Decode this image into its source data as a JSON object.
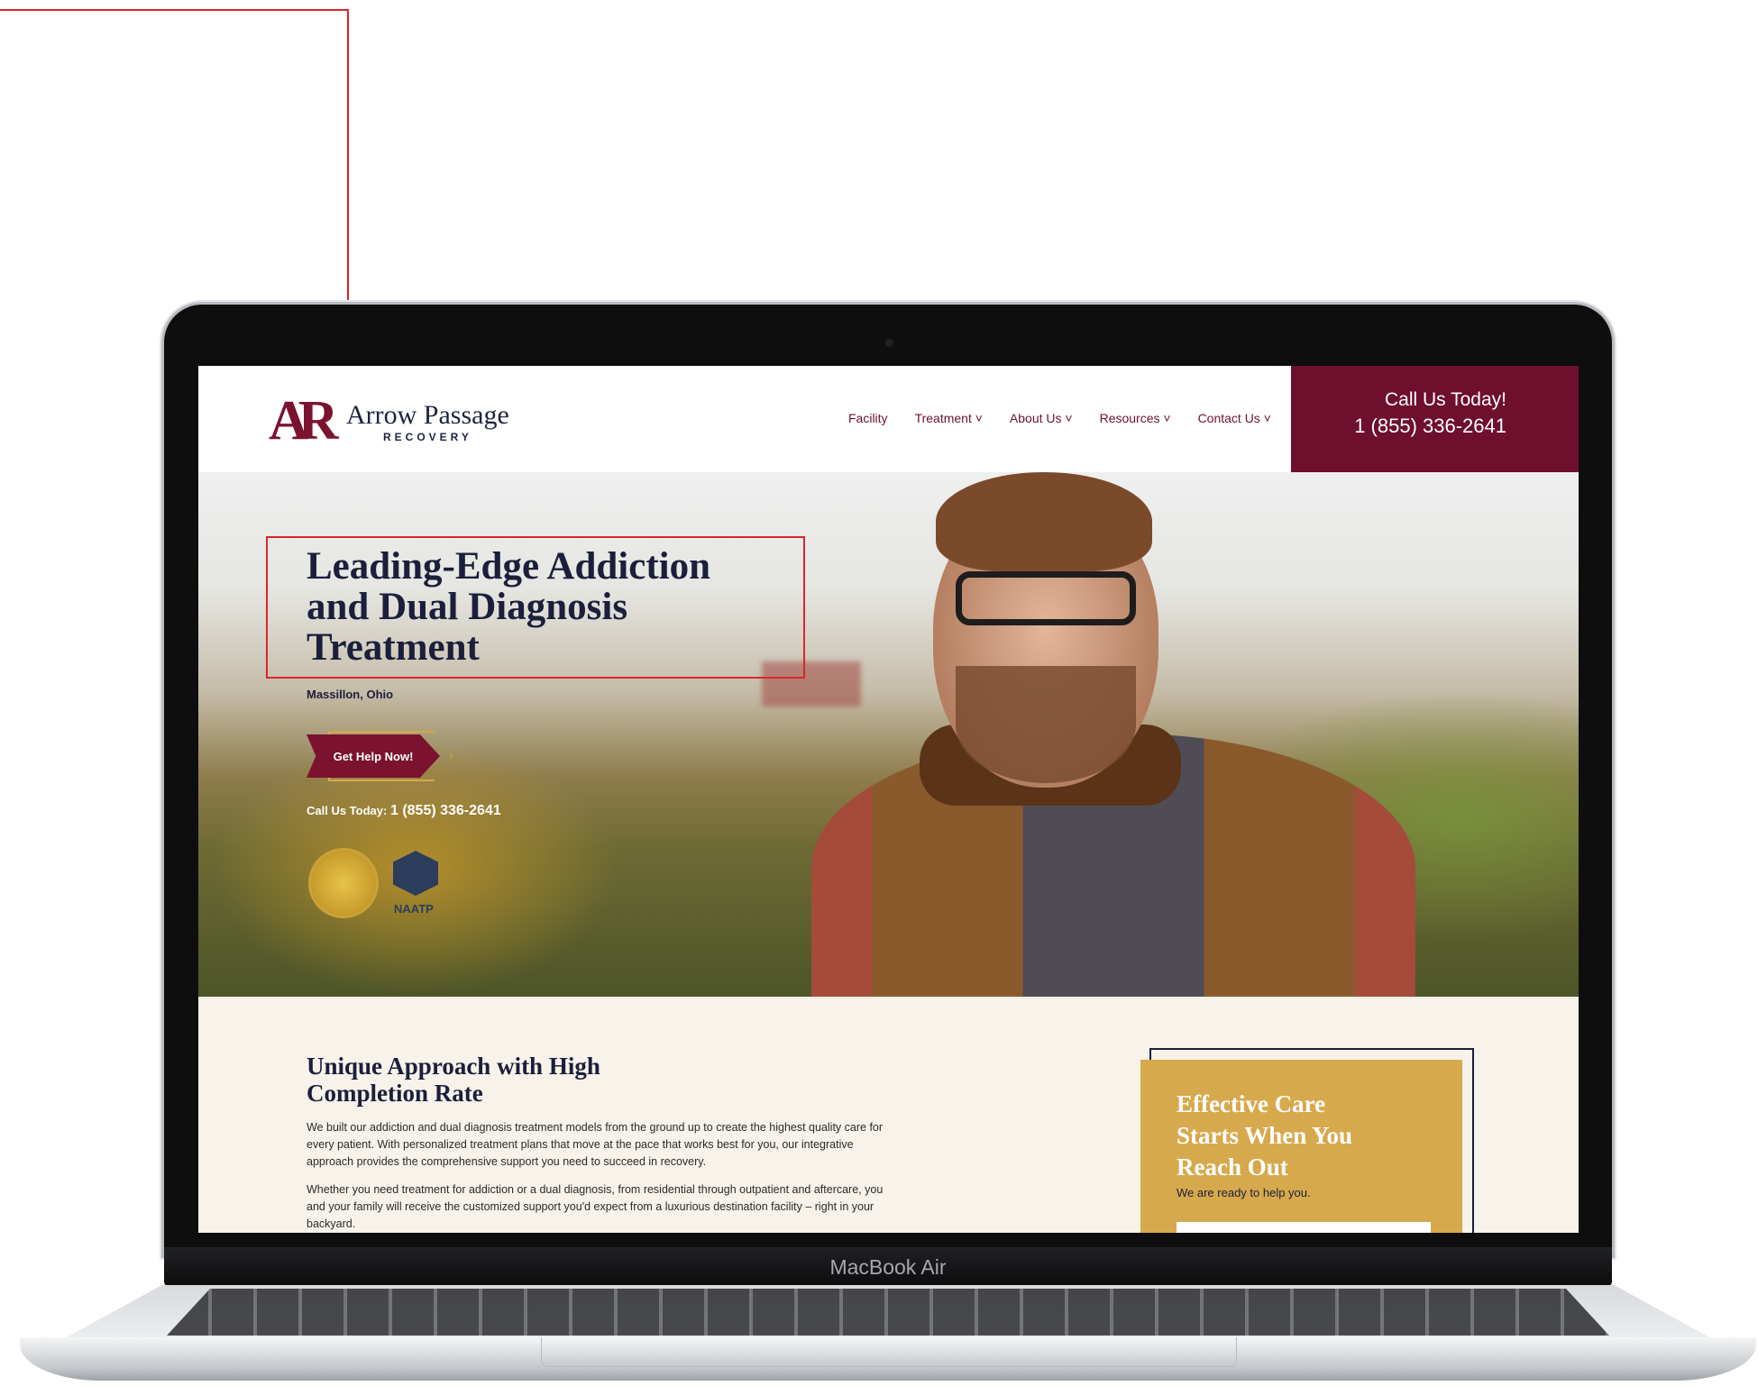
{
  "site": {
    "logo_mark": "AR",
    "logo_name": "Arrow Passage",
    "logo_sub": "RECOVERY"
  },
  "nav": [
    {
      "label": "Facility"
    },
    {
      "label": "Treatment ˅"
    },
    {
      "label": "About Us ˅"
    },
    {
      "label": "Resources ˅"
    },
    {
      "label": "Contact Us ˅"
    }
  ],
  "call_box": {
    "line1": "Call Us Today!",
    "phone": "1 (855) 336-2641"
  },
  "hero": {
    "title": "Leading-Edge Addiction and Dual Diagnosis Treatment",
    "location": "Massillon, Ohio",
    "cta_label": "Get Help Now!",
    "call_label": "Call Us Today:",
    "call_phone": "1 (855) 336-2641",
    "naatp_label": "NAATP"
  },
  "content": {
    "title": "Unique Approach with High Completion Rate",
    "p1": "We built our addiction and dual diagnosis treatment models from the ground up to create the highest quality care for every patient. With personalized treatment plans that move at the pace that works best for you, our integrative approach provides the comprehensive support you need to succeed in recovery.",
    "p2": "Whether you need treatment for addiction or a dual diagnosis, from residential through outpatient and aftercare, you and your family will receive the customized support you'd expect from a luxurious destination facility – right in your backyard."
  },
  "card": {
    "title": "Effective Care Starts When You Reach Out",
    "subtitle": "We are ready to help you."
  },
  "device_label": "MacBook Air",
  "colors": {
    "brand": "#6e0f2e",
    "navy": "#1b1f3b",
    "gold": "#d7a94d",
    "annotation": "#d9262c"
  }
}
